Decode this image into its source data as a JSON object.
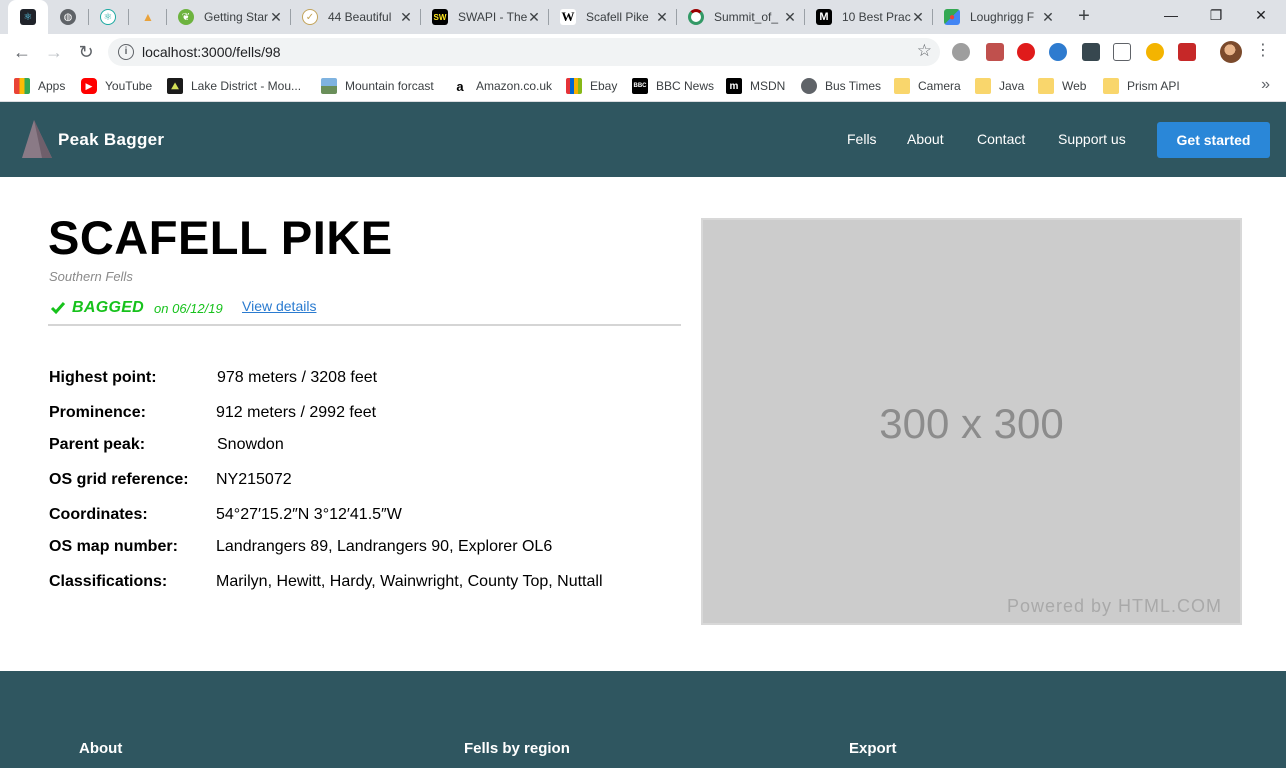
{
  "browser": {
    "tabs": [
      {
        "title": "",
        "icon": "react-icon",
        "color": "#61dafb",
        "active": true
      },
      {
        "title": "",
        "icon": "globe-icon",
        "color": "#5f6368"
      },
      {
        "title": "",
        "icon": "react-icon",
        "color": "#1aa9a1"
      },
      {
        "title": "",
        "icon": "pma-icon",
        "color": "#e9a23b"
      },
      {
        "title": "Getting Star",
        "icon": "spring-leaf-icon",
        "color": "#6db33f"
      },
      {
        "title": "44 Beautiful",
        "icon": "check-circle-icon",
        "color": "#c3a45a"
      },
      {
        "title": "SWAPI - The",
        "icon": "swapi-icon",
        "color": "#000000"
      },
      {
        "title": "Scafell Pike",
        "icon": "wikipedia-icon",
        "color": "#ffffff"
      },
      {
        "title": "Summit_of_",
        "icon": "wikimedia-icon",
        "color": "#339966"
      },
      {
        "title": "10 Best Prac",
        "icon": "medium-icon",
        "color": "#000000"
      },
      {
        "title": "Loughrigg F",
        "icon": "google-maps-icon",
        "color": "#34a853"
      }
    ],
    "address": {
      "url": "localhost:3000/fells/98"
    },
    "bookmarks": [
      {
        "label": "Apps",
        "icon": "apps-grid-icon"
      },
      {
        "label": "YouTube",
        "icon": "youtube-icon"
      },
      {
        "label": "Lake District - Mou...",
        "icon": "mountain-icon"
      },
      {
        "label": "Mountain forcast",
        "icon": "landscape-icon"
      },
      {
        "label": "Amazon.co.uk",
        "icon": "amazon-icon"
      },
      {
        "label": "Ebay",
        "icon": "ebay-icon"
      },
      {
        "label": "BBC News",
        "icon": "bbc-icon"
      },
      {
        "label": "MSDN",
        "icon": "msdn-icon"
      },
      {
        "label": "Bus Times",
        "icon": "globe-icon"
      },
      {
        "label": "Camera",
        "icon": "folder-icon"
      },
      {
        "label": "Java",
        "icon": "folder-icon"
      },
      {
        "label": "Web",
        "icon": "folder-icon"
      },
      {
        "label": "Prism API",
        "icon": "folder-icon"
      }
    ]
  },
  "header": {
    "brand": "Peak Bagger",
    "nav": [
      "Fells",
      "About",
      "Contact",
      "Support us"
    ],
    "cta": "Get started"
  },
  "fell": {
    "name": "SCAFELL PIKE",
    "region": "Southern Fells",
    "status": "BAGGED",
    "bagged_date": "on 06/12/19",
    "details_link": "View details",
    "stats": [
      {
        "label": "Highest point:",
        "value": "978 meters / 3208 feet"
      },
      {
        "label": "Prominence:",
        "value": "912 meters / 2992 feet"
      },
      {
        "label": "Parent peak:",
        "value": "Snowdon"
      },
      {
        "label": "OS grid reference:",
        "value": "NY215072"
      },
      {
        "label": "Coordinates:",
        "value": "54°27′15.2″N 3°12′41.5″W"
      },
      {
        "label": "OS map number:",
        "value": "Landrangers 89, Landrangers 90, Explorer OL6"
      },
      {
        "label": "Classifications:",
        "value": "Marilyn, Hewitt, Hardy, Wainwright, County Top, Nuttall"
      }
    ]
  },
  "image_placeholder": {
    "dimensions": "300 x 300",
    "powered_by": "Powered by HTML.COM"
  },
  "footer": {
    "columns": [
      "About",
      "Fells by region",
      "Export"
    ]
  },
  "colors": {
    "header_bg": "#2f5660",
    "cta_bg": "#2a87d8",
    "bagged_green": "#17c21c",
    "link_blue": "#2a7bd0"
  }
}
